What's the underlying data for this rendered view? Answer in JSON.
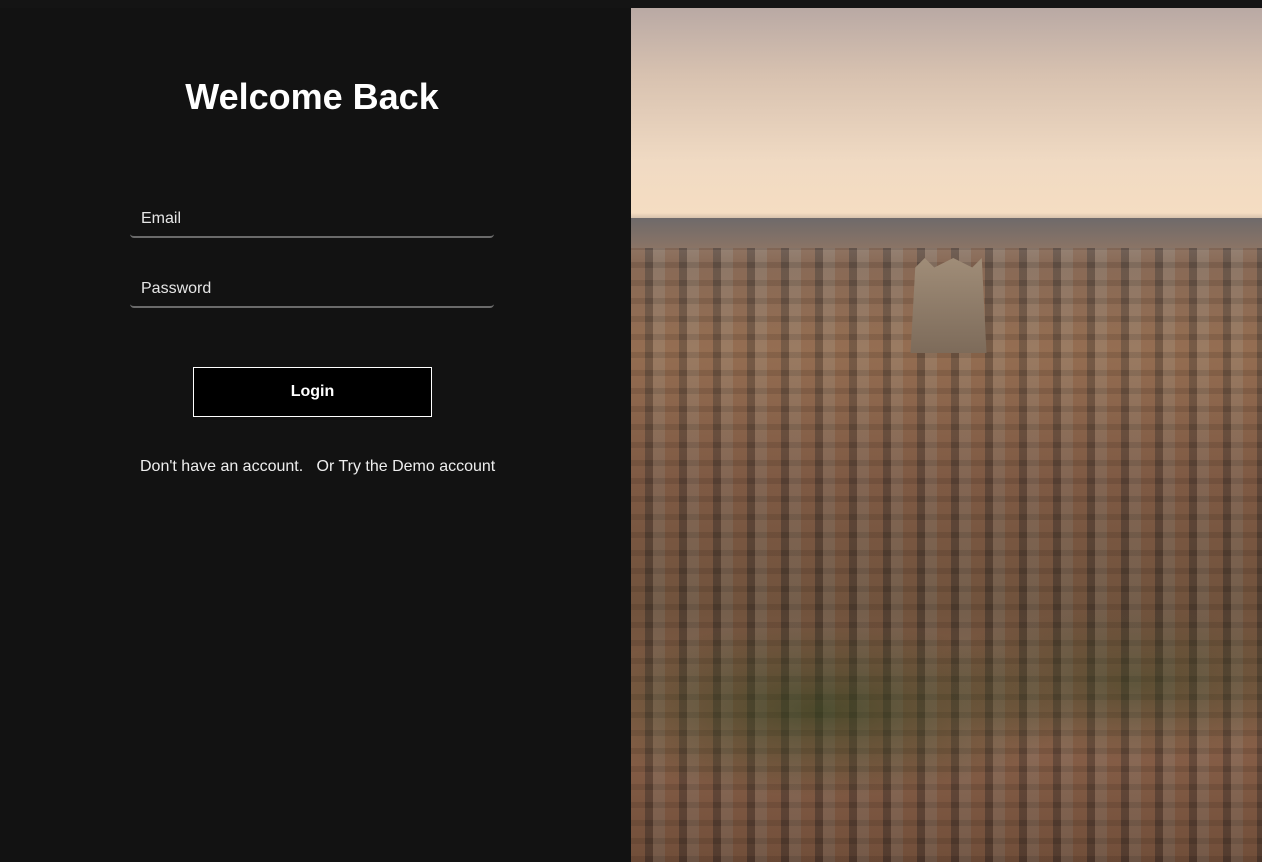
{
  "login": {
    "title": "Welcome Back",
    "email_placeholder": "Email",
    "password_placeholder": "Password",
    "login_label": "Login",
    "signup_link": "Don't have an account.",
    "demo_link": "Or Try the Demo account"
  }
}
